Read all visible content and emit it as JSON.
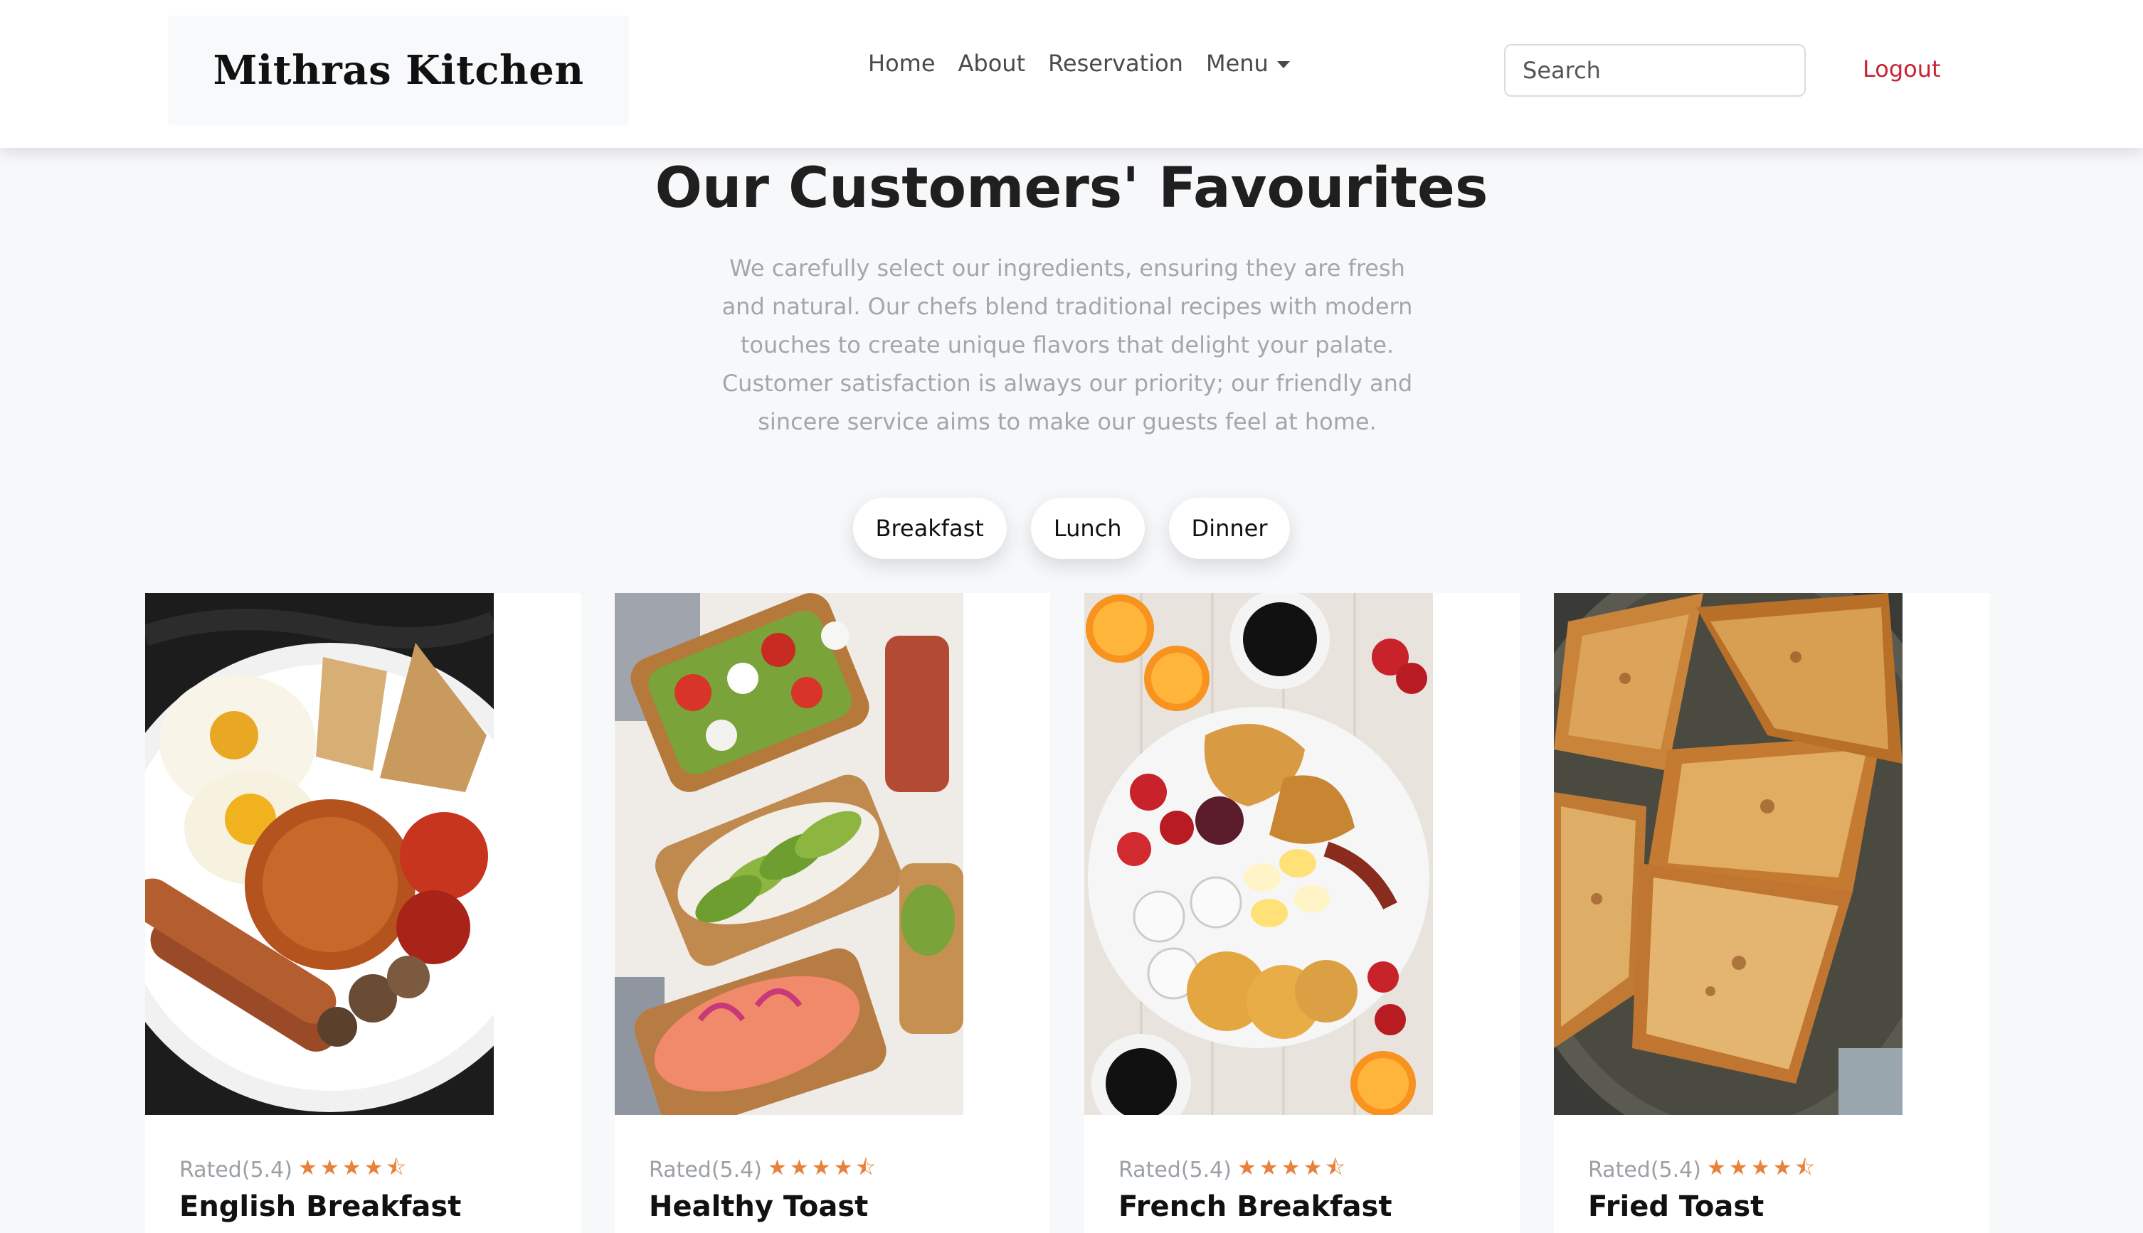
{
  "brand": "Mithras Kitchen",
  "nav": {
    "links": [
      "Home",
      "About",
      "Reservation"
    ],
    "menu_label": "Menu"
  },
  "search": {
    "placeholder": "Search",
    "value": ""
  },
  "logout_label": "Logout",
  "hero": {
    "title": "Our Customers' Favourites",
    "description": "We carefully select our ingredients, ensuring they are fresh and natural. Our chefs blend traditional recipes with modern touches to create unique flavors that delight your palate. Customer satisfaction is always our priority; our friendly and sincere service aims to make our guests feel at home."
  },
  "tabs": [
    "Breakfast",
    "Lunch",
    "Dinner"
  ],
  "cards": [
    {
      "rating_text": "Rated(5.4)",
      "stars": "★★★★⯪",
      "title": "English Breakfast"
    },
    {
      "rating_text": "Rated(5.4)",
      "stars": "★★★★⯪",
      "title": "Healthy Toast"
    },
    {
      "rating_text": "Rated(5.4)",
      "stars": "★★★★⯪",
      "title": "French Breakfast"
    },
    {
      "rating_text": "Rated(5.4)",
      "stars": "★★★★⯪",
      "title": "Fried Toast"
    }
  ],
  "colors": {
    "accent_star": "#e8823a",
    "logout": "#c82333",
    "background": "#f7f8fa"
  }
}
